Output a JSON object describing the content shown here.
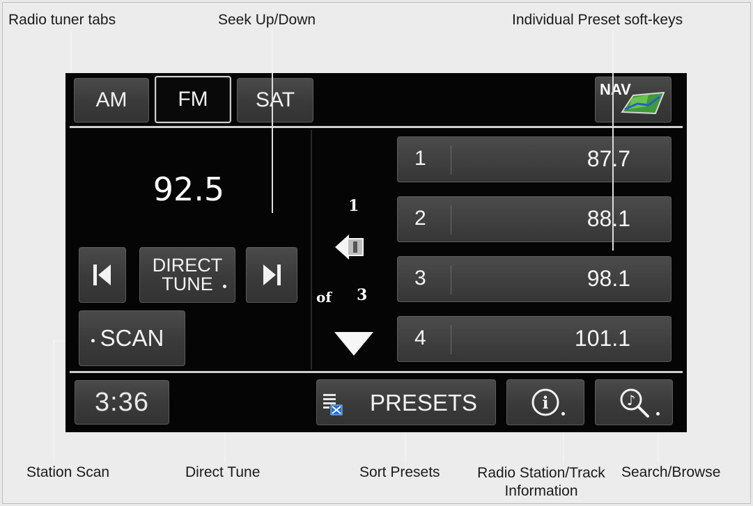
{
  "callouts": {
    "radio_tuner_tabs": "Radio tuner tabs",
    "seek_up_down": "Seek Up/Down",
    "individual_preset_softkeys": "Individual Preset soft-keys",
    "station_scan": "Station Scan",
    "direct_tune": "Direct Tune",
    "sort_presets": "Sort Presets",
    "radio_station_track_info_line1": "Radio Station/Track",
    "radio_station_track_info_line2": "Information",
    "search_browse": "Search/Browse"
  },
  "tabs": [
    {
      "label": "AM",
      "selected": false
    },
    {
      "label": "FM",
      "selected": true
    },
    {
      "label": "SAT",
      "selected": false
    }
  ],
  "nav_label": "NAV",
  "frequency": "92.5",
  "direct_tune": {
    "line1": "DIRECT",
    "line2": "TUNE"
  },
  "scan_label": "SCAN",
  "clock": "3:36",
  "page": {
    "current": "1",
    "of_label": "of",
    "total": "3"
  },
  "presets": [
    {
      "number": "1",
      "frequency": "87.7"
    },
    {
      "number": "2",
      "frequency": "88.1"
    },
    {
      "number": "3",
      "frequency": "98.1"
    },
    {
      "number": "4",
      "frequency": "101.1"
    }
  ],
  "presets_label": "PRESETS",
  "icons": {
    "seek_down": "seek-down-icon",
    "seek_up": "seek-up-icon",
    "page_back": "page-back-icon",
    "scroll_down": "scroll-down-arrow-icon",
    "sort_presets": "sort-presets-icon",
    "info": "info-icon",
    "search": "music-search-icon",
    "nav": "nav-map-icon"
  },
  "colors": {
    "screen_background": "#050505",
    "button_face": "#3f3f3f",
    "text": "#f2f2f2",
    "sort_icon_blue": "#1f6fd8"
  }
}
